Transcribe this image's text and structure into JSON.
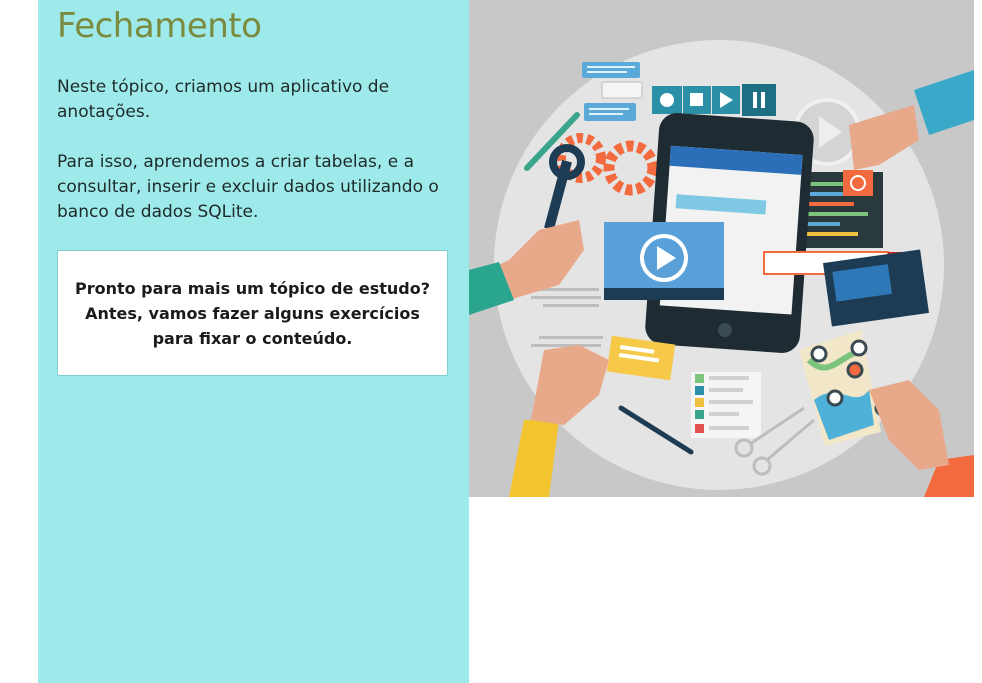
{
  "content": {
    "title": "Fechamento",
    "paragraphs": [
      "Neste tópico, criamos um aplicativo de anotações.",
      "Para isso, aprendemos a criar tabelas, e a consultar, inserir e excluir dados utilizando o banco de dados SQLite."
    ],
    "callout": {
      "lines": [
        "Pronto para mais um tópico de estudo?",
        "Antes, vamos fazer alguns exercícios",
        "para fixar o conteúdo."
      ]
    }
  },
  "colors": {
    "panel_bg": "#9eeaea",
    "title": "#7a8a3e",
    "illustration_bg": "#c8c8c8"
  },
  "illustration": {
    "icons": [
      "smartphone-icon",
      "play-video-icon",
      "gears-icon",
      "wrench-icon",
      "map-pin-icon",
      "chat-bubble-icon",
      "media-controls-icon",
      "scissors-icon",
      "pencil-icon"
    ]
  }
}
